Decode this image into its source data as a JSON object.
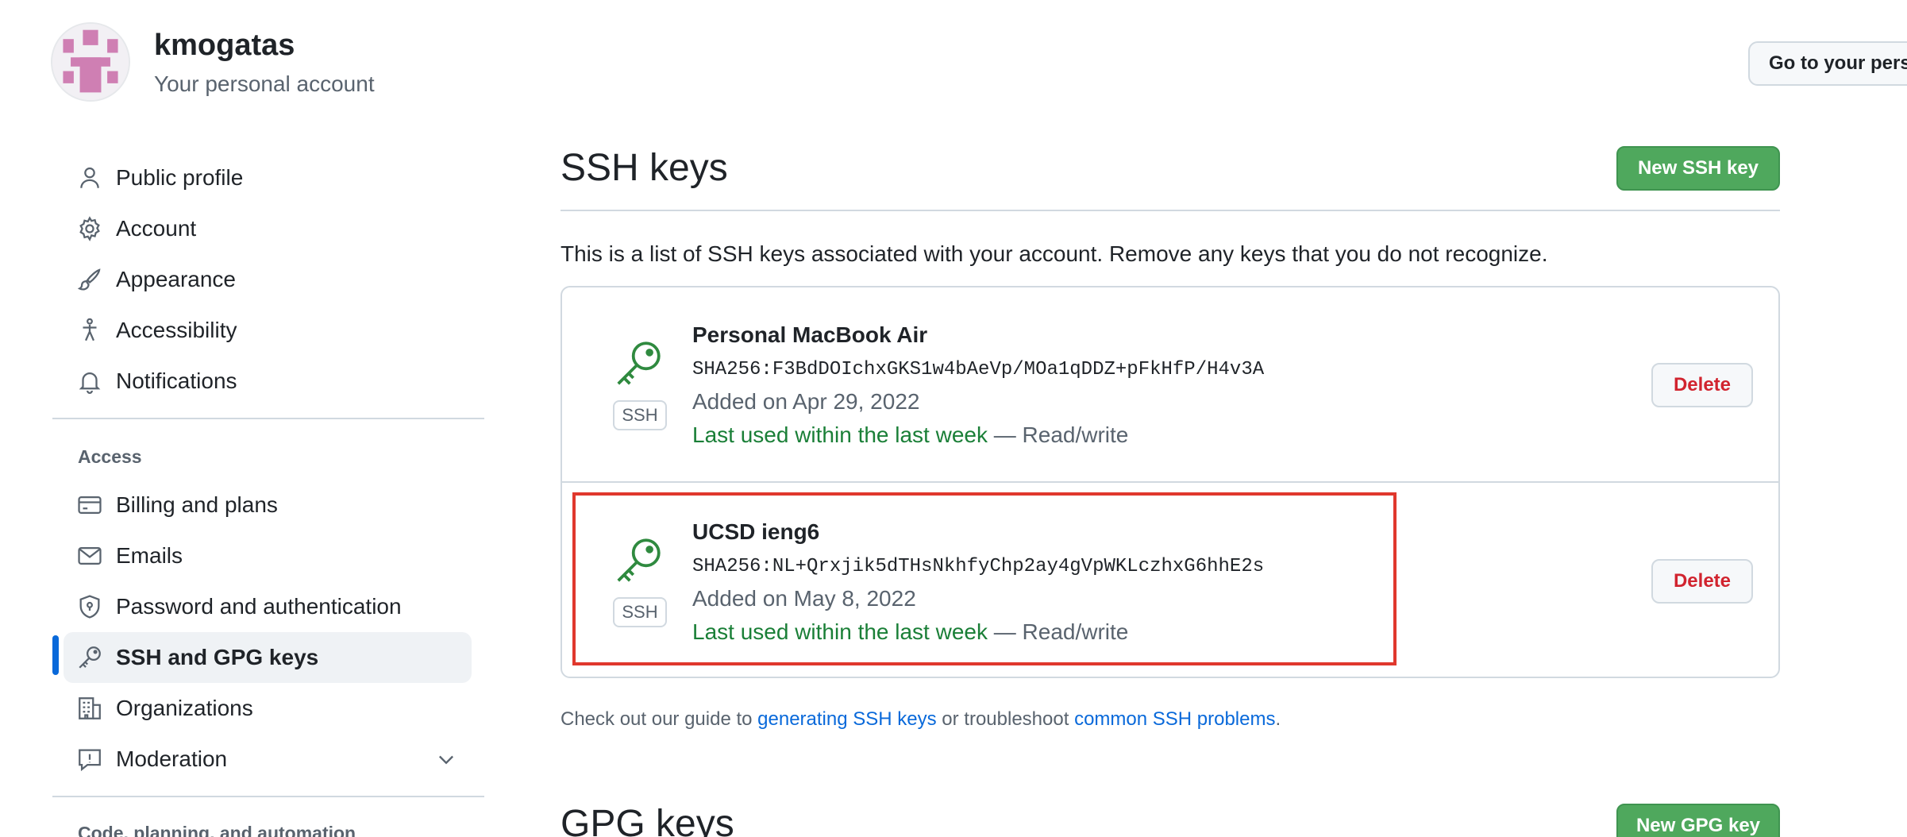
{
  "header": {
    "username": "kmogatas",
    "account_sub": "Your personal account",
    "goto_button": "Go to your personal profile"
  },
  "sidebar": {
    "items_top": [
      {
        "label": "Public profile",
        "icon": "person-icon"
      },
      {
        "label": "Account",
        "icon": "gear-icon"
      },
      {
        "label": "Appearance",
        "icon": "paintbrush-icon"
      },
      {
        "label": "Accessibility",
        "icon": "accessibility-icon"
      },
      {
        "label": "Notifications",
        "icon": "bell-icon"
      }
    ],
    "access_label": "Access",
    "items_access": [
      {
        "label": "Billing and plans",
        "icon": "credit-card-icon"
      },
      {
        "label": "Emails",
        "icon": "mail-icon"
      },
      {
        "label": "Password and authentication",
        "icon": "shield-icon"
      },
      {
        "label": "SSH and GPG keys",
        "icon": "key-icon",
        "active": true
      },
      {
        "label": "Organizations",
        "icon": "organization-icon"
      },
      {
        "label": "Moderation",
        "icon": "report-icon"
      }
    ],
    "code_section_label": "Code, planning, and automation"
  },
  "main": {
    "ssh_title": "SSH keys",
    "new_ssh_button": "New SSH key",
    "intro": "This is a list of SSH keys associated with your account. Remove any keys that you do not recognize.",
    "keys": [
      {
        "title": "Personal MacBook Air",
        "fingerprint": "SHA256:F3BdDOIchxGKS1w4bAeVp/MOa1qDDZ+pFkHfP/H4v3A",
        "added": "Added on Apr 29, 2022",
        "last_used": "Last used within the last week",
        "access": " — Read/write",
        "badge": "SSH",
        "delete_label": "Delete"
      },
      {
        "title": "UCSD ieng6",
        "fingerprint": "SHA256:NL+Qrxjik5dTHsNkhfyChp2ay4gVpWKLczhxG6hhE2s",
        "added": "Added on May 8, 2022",
        "last_used": "Last used within the last week",
        "access": " — Read/write",
        "badge": "SSH",
        "delete_label": "Delete"
      }
    ],
    "guide": {
      "prefix": "Check out our guide to ",
      "link1": "generating SSH keys",
      "middle": " or troubleshoot ",
      "link2": "common SSH problems",
      "suffix": "."
    },
    "gpg_title": "GPG keys",
    "new_gpg_button": "New GPG key"
  },
  "colors": {
    "accent": "#0969da",
    "green_button": "#4fa85d",
    "danger": "#d1242f",
    "highlight": "#e0382d",
    "success_text": "#1a7f37"
  }
}
